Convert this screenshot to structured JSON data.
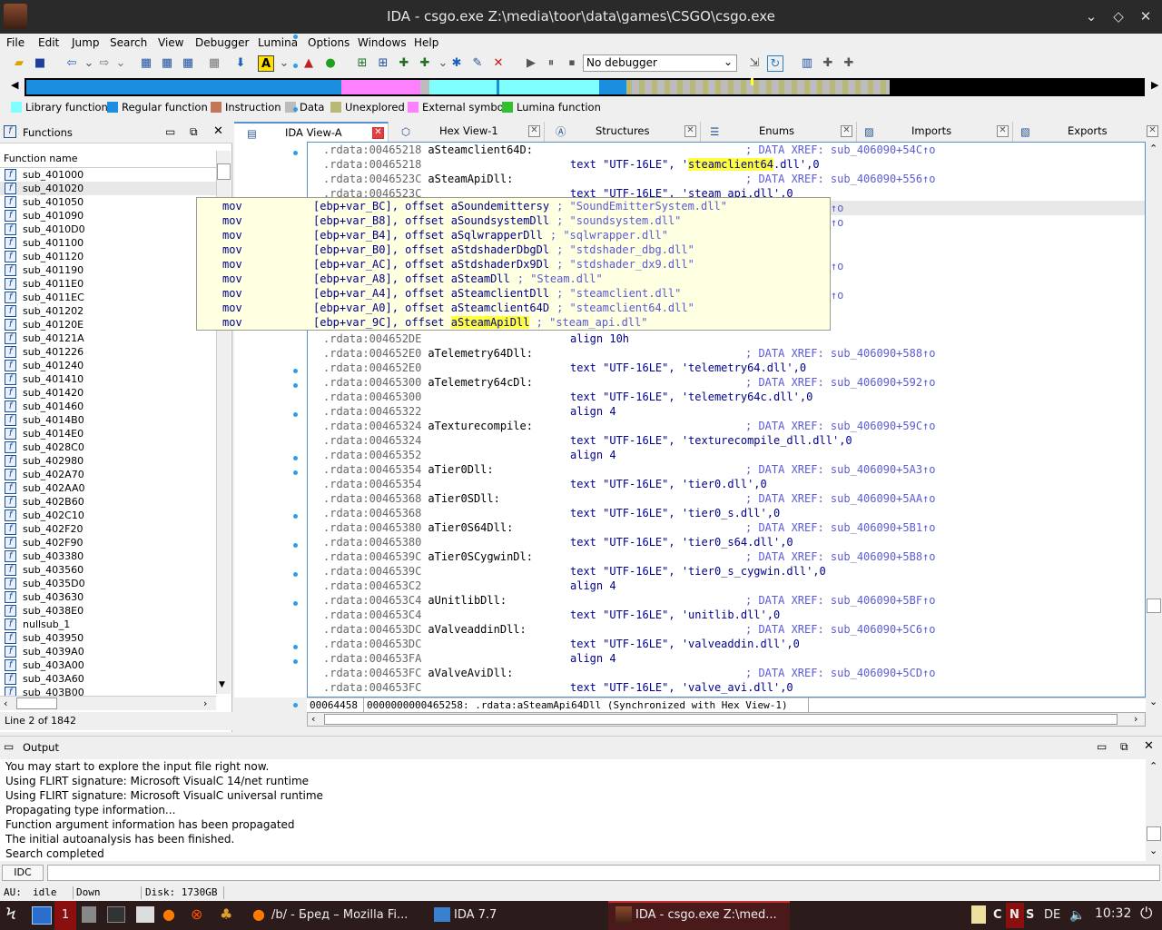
{
  "window": {
    "title": "IDA - csgo.exe Z:\\media\\toor\\data\\games\\CSGO\\csgo.exe"
  },
  "menu": [
    "File",
    "Edit",
    "Jump",
    "Search",
    "View",
    "Debugger",
    "Lumina",
    "Options",
    "Windows",
    "Help"
  ],
  "debugger_select": "No debugger",
  "legend": [
    {
      "label": "Library function",
      "color": "#7fffff"
    },
    {
      "label": "Regular function",
      "color": "#1a8fe0"
    },
    {
      "label": "Instruction",
      "color": "#c07858"
    },
    {
      "label": "Data",
      "color": "#bcbcbc"
    },
    {
      "label": "Unexplored",
      "color": "#b8b878"
    },
    {
      "label": "External symbol",
      "color": "#ff80ff"
    },
    {
      "label": "Lumina function",
      "color": "#30c030"
    }
  ],
  "functions_panel": {
    "title": "Functions",
    "column": "Function name",
    "items": [
      "sub_401000",
      "sub_401020",
      "sub_401050",
      "sub_401090",
      "sub_4010D0",
      "sub_401100",
      "sub_401120",
      "sub_401190",
      "sub_4011E0",
      "sub_4011EC",
      "sub_401202",
      "sub_40120E",
      "sub_40121A",
      "sub_401226",
      "sub_401240",
      "sub_401410",
      "sub_401420",
      "sub_401460",
      "sub_4014B0",
      "sub_4014E0",
      "sub_4028C0",
      "sub_402980",
      "sub_402A70",
      "sub_402AA0",
      "sub_402B60",
      "sub_402C10",
      "sub_402F20",
      "sub_402F90",
      "sub_403380",
      "sub_403560",
      "sub_4035D0",
      "sub_403630",
      "sub_4038E0",
      "nullsub_1",
      "sub_403950",
      "sub_4039A0",
      "sub_403A00",
      "sub_403A60",
      "sub_403B00"
    ],
    "status": "Line 2 of 1842"
  },
  "tabs": [
    {
      "label": "IDA View-A",
      "active": true
    },
    {
      "label": "Hex View-1"
    },
    {
      "label": "Structures"
    },
    {
      "label": "Enums"
    },
    {
      "label": "Imports"
    },
    {
      "label": "Exports"
    }
  ],
  "code_lines": [
    {
      "addr": ".rdata:00465218",
      "label": "aSteamclient64D:",
      "ins": "",
      "cmt": "; DATA XREF: sub_406090+54C↑o"
    },
    {
      "addr": ".rdata:00465218",
      "label": "",
      "ins": "text \"UTF-16LE\", '",
      "hl": "steamclient64",
      "rest": ".dll',0",
      "cmt": ""
    },
    {
      "addr": ".rdata:0046523C",
      "label": "aSteamApiDll:",
      "ins": "",
      "cmt": "; DATA XREF: sub_406090+556↑o"
    },
    {
      "addr": ".rdata:0046523C",
      "label": "",
      "ins": "text \"UTF-16LE\", 'steam_api.dll',0",
      "cmt": ""
    },
    {
      "addr": "",
      "label": "",
      "ins": "",
      "cmt": "ub_406090+560↑o"
    },
    {
      "addr": "",
      "label": "",
      "ins": "",
      "cmt": "ub_406090+56A↑o"
    },
    {
      "addr": "",
      "label": "",
      "ins": "",
      "cmt": ""
    },
    {
      "addr": "",
      "label": "",
      "ins": "",
      "cmt": ""
    },
    {
      "addr": "",
      "label": "",
      "ins": "",
      "cmt": "ub_406090+574↑o"
    },
    {
      "addr": "",
      "label": "",
      "ins": "",
      "cmt": ""
    },
    {
      "addr": "",
      "label": "",
      "ins": "",
      "cmt": "ub_406090+57E↑o"
    },
    {
      "addr": "",
      "label": "",
      "ins": "",
      "cmt": ""
    },
    {
      "addr": "",
      "label": "",
      "ins": "",
      "cmt": ""
    },
    {
      "addr": ".rdata:004652DE",
      "label": "",
      "ins": "align 10h",
      "cmt": ""
    },
    {
      "addr": ".rdata:004652E0",
      "label": "aTelemetry64Dll:",
      "ins": "",
      "cmt": "; DATA XREF: sub_406090+588↑o"
    },
    {
      "addr": ".rdata:004652E0",
      "label": "",
      "ins": "text \"UTF-16LE\", 'telemetry64.dll',0",
      "cmt": ""
    },
    {
      "addr": ".rdata:00465300",
      "label": "aTelemetry64cDl:",
      "ins": "",
      "cmt": "; DATA XREF: sub_406090+592↑o"
    },
    {
      "addr": ".rdata:00465300",
      "label": "",
      "ins": "text \"UTF-16LE\", 'telemetry64c.dll',0",
      "cmt": ""
    },
    {
      "addr": ".rdata:00465322",
      "label": "",
      "ins": "align 4",
      "cmt": ""
    },
    {
      "addr": ".rdata:00465324",
      "label": "aTexturecompile:",
      "ins": "",
      "cmt": "; DATA XREF: sub_406090+59C↑o"
    },
    {
      "addr": ".rdata:00465324",
      "label": "",
      "ins": "text \"UTF-16LE\", 'texturecompile_dll.dll',0",
      "cmt": ""
    },
    {
      "addr": ".rdata:00465352",
      "label": "",
      "ins": "align 4",
      "cmt": ""
    },
    {
      "addr": ".rdata:00465354",
      "label": "aTier0Dll:",
      "ins": "",
      "cmt": "; DATA XREF: sub_406090+5A3↑o"
    },
    {
      "addr": ".rdata:00465354",
      "label": "",
      "ins": "text \"UTF-16LE\", 'tier0.dll',0",
      "cmt": ""
    },
    {
      "addr": ".rdata:00465368",
      "label": "aTier0SDll:",
      "ins": "",
      "cmt": "; DATA XREF: sub_406090+5AA↑o"
    },
    {
      "addr": ".rdata:00465368",
      "label": "",
      "ins": "text \"UTF-16LE\", 'tier0_s.dll',0",
      "cmt": ""
    },
    {
      "addr": ".rdata:00465380",
      "label": "aTier0S64Dll:",
      "ins": "",
      "cmt": "; DATA XREF: sub_406090+5B1↑o"
    },
    {
      "addr": ".rdata:00465380",
      "label": "",
      "ins": "text \"UTF-16LE\", 'tier0_s64.dll',0",
      "cmt": ""
    },
    {
      "addr": ".rdata:0046539C",
      "label": "aTier0SCygwinDl:",
      "ins": "",
      "cmt": "; DATA XREF: sub_406090+5B8↑o"
    },
    {
      "addr": ".rdata:0046539C",
      "label": "",
      "ins": "text \"UTF-16LE\", 'tier0_s_cygwin.dll',0",
      "cmt": ""
    },
    {
      "addr": ".rdata:004653C2",
      "label": "",
      "ins": "align 4",
      "cmt": ""
    },
    {
      "addr": ".rdata:004653C4",
      "label": "aUnitlibDll:",
      "ins": "",
      "cmt": "; DATA XREF: sub_406090+5BF↑o"
    },
    {
      "addr": ".rdata:004653C4",
      "label": "",
      "ins": "text \"UTF-16LE\", 'unitlib.dll',0",
      "cmt": ""
    },
    {
      "addr": ".rdata:004653DC",
      "label": "aValveaddinDll:",
      "ins": "",
      "cmt": "; DATA XREF: sub_406090+5C6↑o"
    },
    {
      "addr": ".rdata:004653DC",
      "label": "",
      "ins": "text \"UTF-16LE\", 'valveaddin.dll',0",
      "cmt": ""
    },
    {
      "addr": ".rdata:004653FA",
      "label": "",
      "ins": "align 4",
      "cmt": ""
    },
    {
      "addr": ".rdata:004653FC",
      "label": "aValveAviDll:",
      "ins": "",
      "cmt": "; DATA XREF: sub_406090+5CD↑o"
    },
    {
      "addr": ".rdata:004653FC",
      "label": "",
      "ins": "text \"UTF-16LE\", 'valve_avi.dll',0",
      "cmt": ""
    }
  ],
  "popup_lines": [
    {
      "op": "mov",
      "args": "[ebp+var_BC], offset aSoundemittersy",
      "cmt": "; \"SoundEmitterSystem.dll\""
    },
    {
      "op": "mov",
      "args": "[ebp+var_B8], offset aSoundsystemDll",
      "cmt": "; \"soundsystem.dll\""
    },
    {
      "op": "mov",
      "args": "[ebp+var_B4], offset aSqlwrapperDll",
      "cmt": "; \"sqlwrapper.dll\""
    },
    {
      "op": "mov",
      "args": "[ebp+var_B0], offset aStdshaderDbgDl",
      "cmt": "; \"stdshader_dbg.dll\""
    },
    {
      "op": "mov",
      "args": "[ebp+var_AC], offset aStdshaderDx9Dl",
      "cmt": "; \"stdshader_dx9.dll\""
    },
    {
      "op": "mov",
      "args": "[ebp+var_A8], offset aSteamDll",
      "cmt": "; \"Steam.dll\""
    },
    {
      "op": "mov",
      "args": "[ebp+var_A4], offset aSteamclientDll",
      "cmt": "; \"steamclient.dll\""
    },
    {
      "op": "mov",
      "args": "[ebp+var_A0], offset aSteamclient64D",
      "cmt": "; \"steamclient64.dll\""
    },
    {
      "op": "mov",
      "args": "[ebp+var_9C], offset ",
      "hl": "aSteamApiDll",
      "cmt": " ; \"steam_api.dll\""
    }
  ],
  "syncbar": {
    "offset": "00064458",
    "text": "0000000000465258: .rdata:aSteamApi64Dll (Synchronized with Hex View-1)"
  },
  "output": {
    "title": "Output",
    "lines": [
      "You may start to explore the input file right now.",
      "Using FLIRT signature: Microsoft VisualC 14/net runtime",
      "Using FLIRT signature: Microsoft VisualC universal runtime",
      "Propagating type information...",
      "Function argument information has been propagated",
      "The initial autoanalysis has been finished.",
      "Search completed"
    ]
  },
  "idc_label": "IDC",
  "status": {
    "au": "AU:",
    "state": "idle",
    "dir": "Down",
    "disk": "Disk: 1730GB"
  },
  "taskbar": {
    "firefox": "/b/ - Бред – Mozilla Fi...",
    "ida77": "IDA 7.7",
    "ida_task": "IDA - csgo.exe Z:\\med...",
    "lang": "DE",
    "time": "10:32",
    "ws1": "1"
  }
}
